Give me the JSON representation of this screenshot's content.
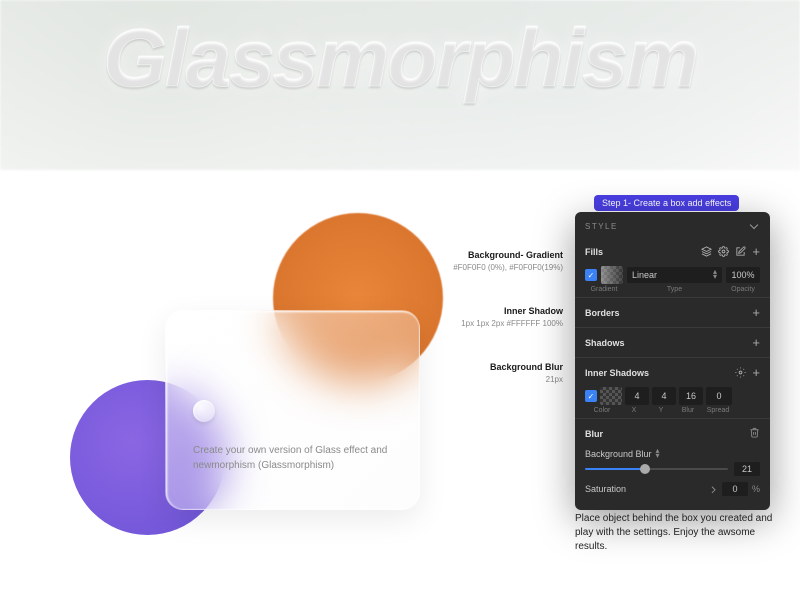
{
  "header": {
    "title": "Glassmorphism"
  },
  "card": {
    "description": "Create your own version of Glass effect and newmorphism (Glassmorphism)"
  },
  "callouts": {
    "bg_gradient": {
      "label": "Background- Gradient",
      "value": "#F0F0F0 (0%), #F0F0F0(19%)"
    },
    "inner_shadow": {
      "label": "Inner Shadow",
      "value": "1px 1px 2px #FFFFFF 100%"
    },
    "bg_blur": {
      "label": "Background Blur",
      "value": "21px"
    }
  },
  "step": {
    "label": "Step 1- Create a box add effects"
  },
  "panel": {
    "style_label": "STYLE",
    "fills": {
      "label": "Fills",
      "type_label": "Linear",
      "opacity": "100%",
      "sub_gradient": "Gradient",
      "sub_type": "Type",
      "sub_opacity": "Opacity"
    },
    "borders": {
      "label": "Borders"
    },
    "shadows": {
      "label": "Shadows"
    },
    "inner_shadows": {
      "label": "Inner Shadows",
      "x": "4",
      "y": "4",
      "blur": "16",
      "spread": "0",
      "sub_color": "Color",
      "sub_x": "X",
      "sub_y": "Y",
      "sub_blur": "Blur",
      "sub_spread": "Spread"
    },
    "blur": {
      "label": "Blur",
      "type": "Background Blur",
      "value": "21",
      "saturation_label": "Saturation",
      "saturation_value": "0",
      "pct": "%"
    }
  },
  "footnote": "Place object behind the box you created and play with the settings. Enjoy the awsome results.",
  "colors": {
    "accent": "#4a3fe4",
    "orange": "#e9863a",
    "purple": "#7a5ee0"
  }
}
